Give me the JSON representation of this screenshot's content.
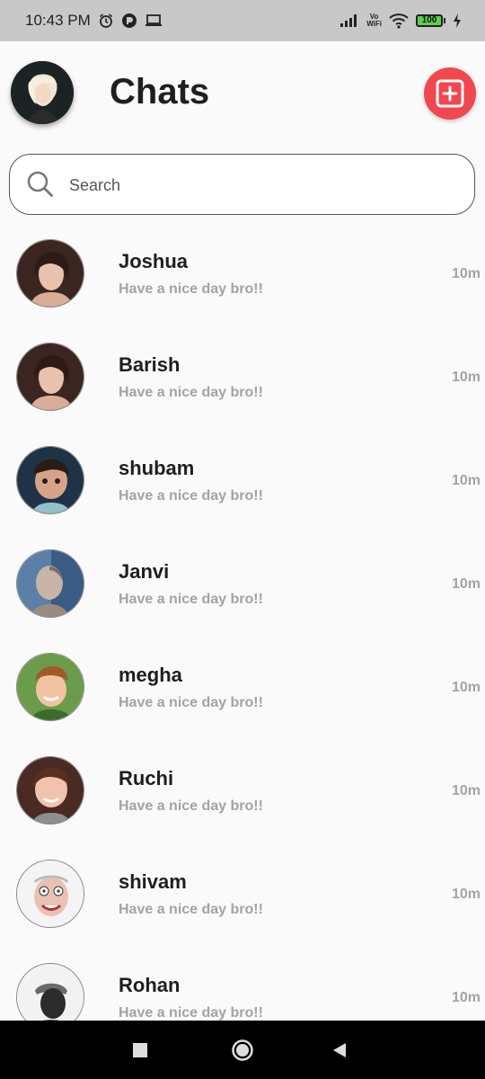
{
  "status_bar": {
    "time": "10:43 PM",
    "battery": "100",
    "vowifi_top": "Vo",
    "vowifi_bottom": "WiFi",
    "icons": [
      "alarm-icon",
      "app-notification-icon",
      "laptop-icon",
      "signal-icon",
      "vowifi-icon",
      "wifi-icon",
      "battery-icon",
      "charging-icon"
    ]
  },
  "header": {
    "title": "Chats",
    "new_chat_icon": "add-square-icon",
    "accent_color": "#f1474f"
  },
  "search": {
    "placeholder": "Search"
  },
  "chats": [
    {
      "name": "Joshua",
      "preview": "Have a nice day bro!!",
      "time": "10m"
    },
    {
      "name": "Barish",
      "preview": "Have a nice day bro!!",
      "time": "10m"
    },
    {
      "name": "shubam",
      "preview": "Have a nice day bro!!",
      "time": "10m"
    },
    {
      "name": "Janvi",
      "preview": "Have a nice day bro!!",
      "time": "10m"
    },
    {
      "name": "megha",
      "preview": "Have a nice day bro!!",
      "time": "10m"
    },
    {
      "name": "Ruchi",
      "preview": "Have a nice day bro!!",
      "time": "10m"
    },
    {
      "name": "shivam",
      "preview": "Have a nice day bro!!",
      "time": "10m"
    },
    {
      "name": "Rohan",
      "preview": "Have a nice day bro!!",
      "time": "10m"
    }
  ],
  "nav_bar": {
    "icons": [
      "recents-square-icon",
      "home-circle-icon",
      "back-triangle-icon"
    ]
  }
}
